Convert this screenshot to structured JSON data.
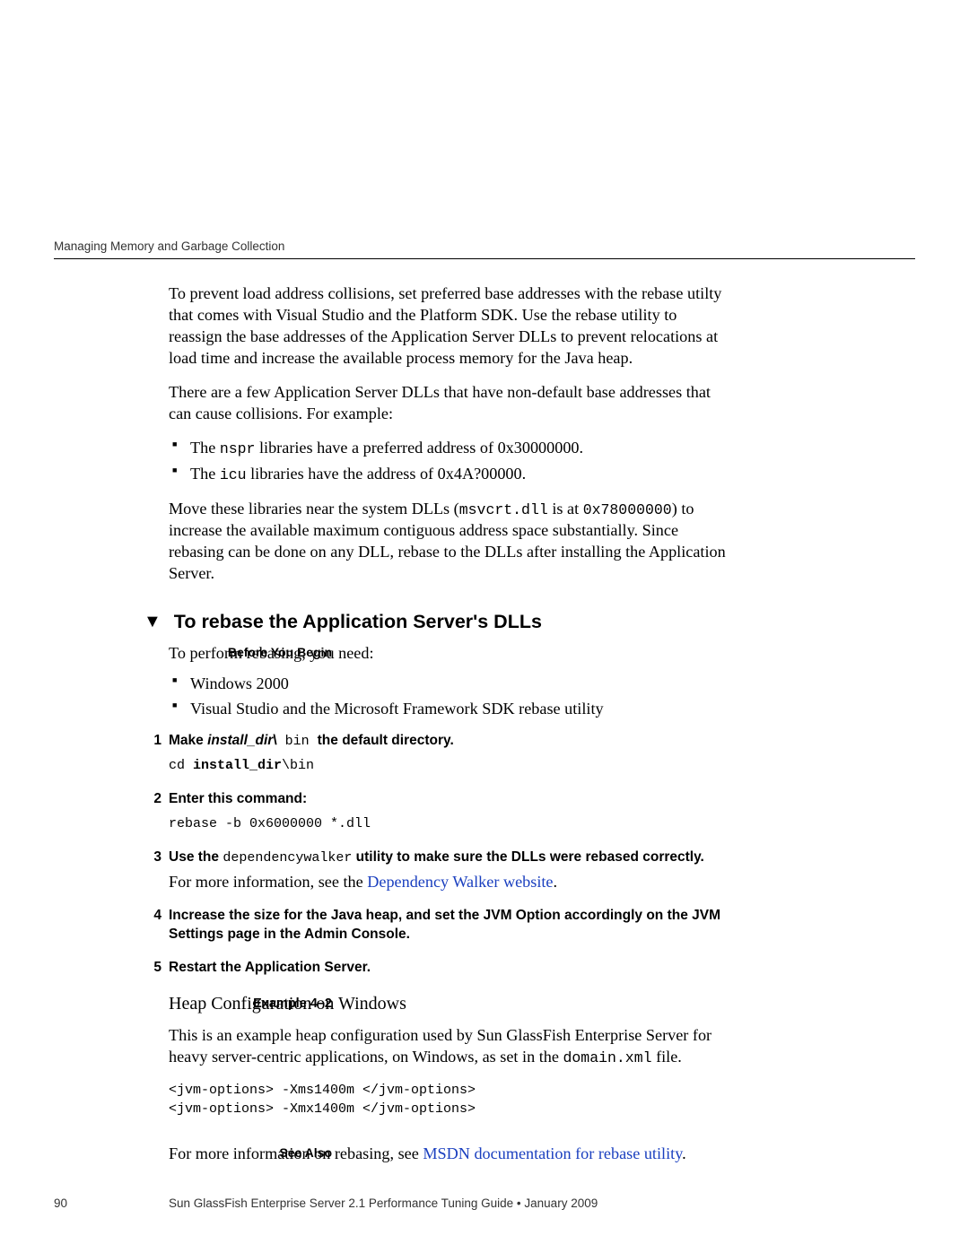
{
  "runningHead": "Managing Memory and Garbage Collection",
  "intro": {
    "p1a": "To prevent load address collisions, set preferred base addresses with the rebase utilty that comes with Visual Studio and the Platform SDK. Use the rebase utility to reassign the base addresses of the Application Server DLLs to prevent relocations at load time and increase the available process memory for the Java heap.",
    "p2": "There are a few Application Server DLLs that have non-default base addresses that can cause collisions. For example:",
    "li1_a": "The ",
    "li1_m": "nspr",
    "li1_b": " libraries have a preferred address of 0x30000000.",
    "li2_a": "The ",
    "li2_m": "icu",
    "li2_b": " libraries have the address of 0x4A?00000.",
    "p3_a": "Move these libraries near the system DLLs (",
    "p3_m1": "msvcrt.dll",
    "p3_b": " is at ",
    "p3_m2": "0x78000000",
    "p3_c": ") to increase the available maximum contiguous address space substantially. Since rebasing can be done on any DLL, rebase to the DLLs after installing the Application Server."
  },
  "task": {
    "arrow": "▼",
    "title": "To rebase the Application Server's DLLs",
    "beforeLabel": "Before You Begin",
    "beforeText": "To perform rebasing, you need:",
    "need1": "Windows 2000",
    "need2": "Visual Studio and the Microsoft Framework SDK rebase utility"
  },
  "steps": {
    "s1": {
      "n": "1",
      "h_a": "Make ",
      "h_i": "install_dir",
      "h_b": "\\",
      "h_m": " bin ",
      "h_c": "the default directory.",
      "code_a": "cd ",
      "code_b": "install_dir",
      "code_c": "\\bin"
    },
    "s2": {
      "n": "2",
      "h": "Enter this command:",
      "code": "rebase -b 0x6000000 *.dll"
    },
    "s3": {
      "n": "3",
      "h_a": "Use the ",
      "h_m": "dependencywalker",
      "h_b": " utility to make sure the DLLs were rebased correctly.",
      "body_a": "For more information, see the ",
      "body_link": "Dependency Walker website",
      "body_b": "."
    },
    "s4": {
      "n": "4",
      "h": "Increase the size for the Java heap, and set the JVM Option accordingly on the JVM Settings page in the Admin Console."
    },
    "s5": {
      "n": "5",
      "h": "Restart the Application Server."
    }
  },
  "example": {
    "label": "Example 4–2",
    "title": "Heap Configuration on Windows",
    "p_a": "This is an example heap configuration used by Sun GlassFish Enterprise Server for heavy server-centric applications, on Windows, as set in the ",
    "p_m": "domain.xml",
    "p_b": " file.",
    "code": "<jvm-options> -Xms1400m </jvm-options>\n<jvm-options> -Xmx1400m </jvm-options>"
  },
  "seeAlso": {
    "label": "See Also",
    "text_a": "For more information on rebasing, see ",
    "link": "MSDN documentation for rebase utility",
    "text_b": "."
  },
  "footer": {
    "page": "90",
    "text": "Sun GlassFish Enterprise Server 2.1 Performance Tuning Guide • January 2009"
  }
}
